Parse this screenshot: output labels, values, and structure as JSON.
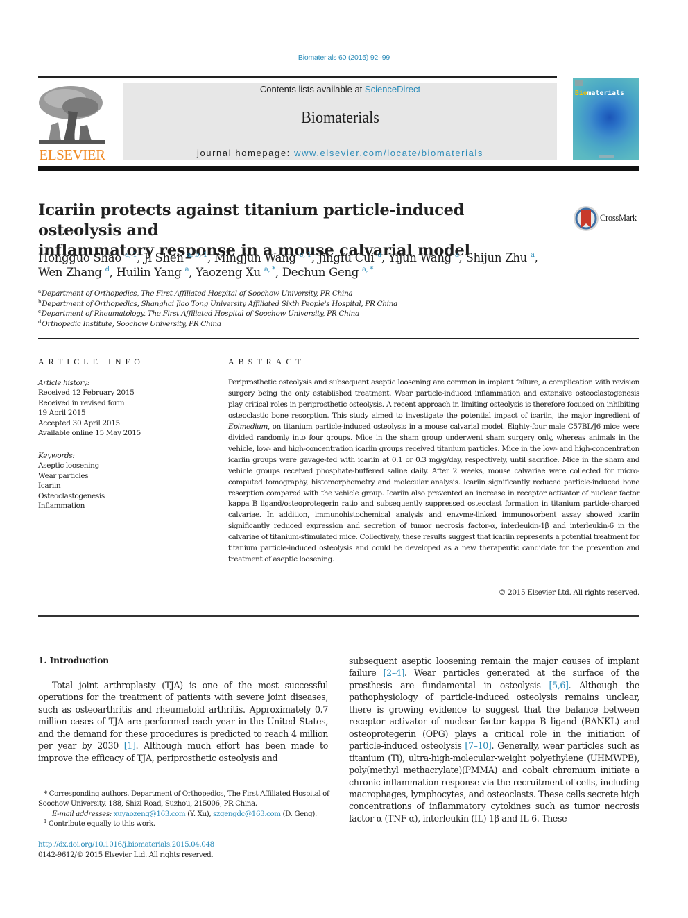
{
  "header": {
    "citation": "Biomaterials 60 (2015) 92–99",
    "contents_prefix": "Contents lists available at ",
    "contents_link": "ScienceDirect",
    "journal_name": "Biomaterials",
    "homepage_prefix": "journal homepage: ",
    "homepage_link": "www.elsevier.com/locate/biomaterials",
    "publisher_logo_text": "ELSEVIER",
    "cover_title_highlight": "Bio",
    "cover_title_rest": "materials",
    "crossmark_label": "CrossMark",
    "colors": {
      "link": "#2a8bb8",
      "elsevier_orange": "#f08a24",
      "band": "#e7e7e7"
    }
  },
  "article": {
    "title_line1": "Icariin protects against titanium particle-induced osteolysis and",
    "title_line2": "inflammatory response in a mouse calvarial model",
    "authors": [
      {
        "name": "Hongguo Shao",
        "sup": "a, 1",
        "sep": ", "
      },
      {
        "name": "Ji Shen",
        "sup": "a, b, 1",
        "sep": ", "
      },
      {
        "name": "Mingjun Wang",
        "sup": "c, 1",
        "sep": ", "
      },
      {
        "name": "Jingfu Cui",
        "sup": "a",
        "sep": ", "
      },
      {
        "name": "Yijun Wang",
        "sup": "a",
        "sep": ", "
      },
      {
        "name": "Shijun Zhu",
        "sup": "a",
        "sep": ","
      },
      {
        "name": "Wen Zhang",
        "sup": "d",
        "sep": ", "
      },
      {
        "name": "Huilin Yang",
        "sup": "a",
        "sep": ", "
      },
      {
        "name": "Yaozeng Xu",
        "sup": "a, *",
        "sep": ", "
      },
      {
        "name": "Dechun Geng",
        "sup": "a, *",
        "sep": ""
      }
    ],
    "affiliations": [
      {
        "key": "a",
        "text": "Department of Orthopedics, The First Affiliated Hospital of Soochow University, PR China"
      },
      {
        "key": "b",
        "text": "Department of Orthopedics, Shanghai Jiao Tong University Affiliated Sixth People's Hospital, PR China"
      },
      {
        "key": "c",
        "text": "Department of Rheumatology, The First Affiliated Hospital of Soochow University, PR China"
      },
      {
        "key": "d",
        "text": "Orthopedic Institute, Soochow University, PR China"
      }
    ]
  },
  "article_info": {
    "heading": "ARTICLE INFO",
    "history_label": "Article history:",
    "history": [
      "Received 12 February 2015",
      "Received in revised form",
      "19 April 2015",
      "Accepted 30 April 2015",
      "Available online 15 May 2015"
    ],
    "keywords_label": "Keywords:",
    "keywords": [
      "Aseptic loosening",
      "Wear particles",
      "Icariin",
      "Osteoclastogenesis",
      "Inflammation"
    ]
  },
  "abstract": {
    "heading": "ABSTRACT",
    "part1": "Periprosthetic osteolysis and subsequent aseptic loosening are common in implant failure, a complication with revision surgery being the only established treatment. Wear particle-induced inflammation and extensive osteoclastogenesis play critical roles in periprosthetic osteolysis. A recent approach in limiting osteolysis is therefore focused on inhibiting osteoclastic bone resorption. This study aimed to investigate the potential impact of icariin, the major ingredient of ",
    "italic": "Epimedium",
    "part2": ", on titanium particle-induced osteolysis in a mouse calvarial model. Eighty-four male C57BL/J6 mice were divided randomly into four groups. Mice in the sham group underwent sham surgery only, whereas animals in the vehicle, low- and high-concentration icariin groups received titanium particles. Mice in the low- and high-concentration icariin groups were gavage-fed with icariin at 0.1 or 0.3 mg/g/day, respectively, until sacrifice. Mice in the sham and vehicle groups received phosphate-buffered saline daily. After 2 weeks, mouse calvariae were collected for micro-computed tomography, histomorphometry and molecular analysis. Icariin significantly reduced particle-induced bone resorption compared with the vehicle group. Icariin also prevented an increase in receptor activator of nuclear factor kappa B ligand/osteoprotegerin ratio and subsequently suppressed osteoclast formation in titanium particle-charged calvariae. In addition, immunohistochemical analysis and enzyme-linked immunosorbent assay showed icariin significantly reduced expression and secretion of tumor necrosis factor-α, interleukin-1β and interleukin-6 in the calvariae of titanium-stimulated mice. Collectively, these results suggest that icariin represents a potential treatment for titanium particle-induced osteolysis and could be developed as a new therapeutic candidate for the prevention and treatment of aseptic loosening.",
    "copyright": "© 2015 Elsevier Ltd. All rights reserved."
  },
  "introduction": {
    "heading": "1.  Introduction",
    "left": {
      "p1": "Total joint arthroplasty (TJA) is one of the most successful operations for the treatment of patients with severe joint diseases, such as osteoarthritis and rheumatoid arthritis. Approximately 0.7 million cases of TJA are performed each year in the United States, and the demand for these procedures is predicted to reach 4 million per year by 2030 ",
      "ref1": "[1]",
      "p2": ". Although much effort has been made to improve the efficacy of TJA, periprosthetic osteolysis and"
    },
    "right": {
      "t1": "subsequent aseptic loosening remain the major causes of implant failure ",
      "ref1": "[2–4]",
      "t2": ". Wear particles generated at the surface of the prosthesis are fundamental in osteolysis ",
      "ref2": "[5,6]",
      "t3": ". Although the pathophysiology of particle-induced osteolysis remains unclear, there is growing evidence to suggest that the balance between receptor activator of nuclear factor kappa B ligand (RANKL) and osteoprotegerin (OPG) plays a critical role in the initiation of particle-induced osteolysis ",
      "ref3": "[7–10]",
      "t4": ". Generally, wear particles such as titanium (Ti), ultra-high-molecular-weight polyethylene (UHMWPE), poly(methyl methacrylate)(PMMA) and cobalt chromium initiate a chronic inflammation response via the recruitment of cells, including macrophages, lymphocytes, and osteoclasts. These cells secrete high concentrations of inflammatory cytokines such as tumor necrosis factor-α (TNF-α), interleukin (IL)-1β and IL-6. These"
    }
  },
  "footnotes": {
    "corresponding": "* Corresponding authors. Department of Orthopedics, The First Affiliated Hospital of Soochow University, 188, Shizi Road, Suzhou, 215006, PR China.",
    "email_label": "E-mail addresses: ",
    "email1": "xuyaozeng@163.com",
    "email1_who": " (Y. Xu), ",
    "email2": "szgengdc@163.com",
    "email2_who": " (D. Geng).",
    "equal_sup": "1",
    "equal": " Contribute equally to this work.",
    "doi": "http://dx.doi.org/10.1016/j.biomaterials.2015.04.048",
    "issn": "0142-9612/© 2015 Elsevier Ltd. All rights reserved."
  }
}
